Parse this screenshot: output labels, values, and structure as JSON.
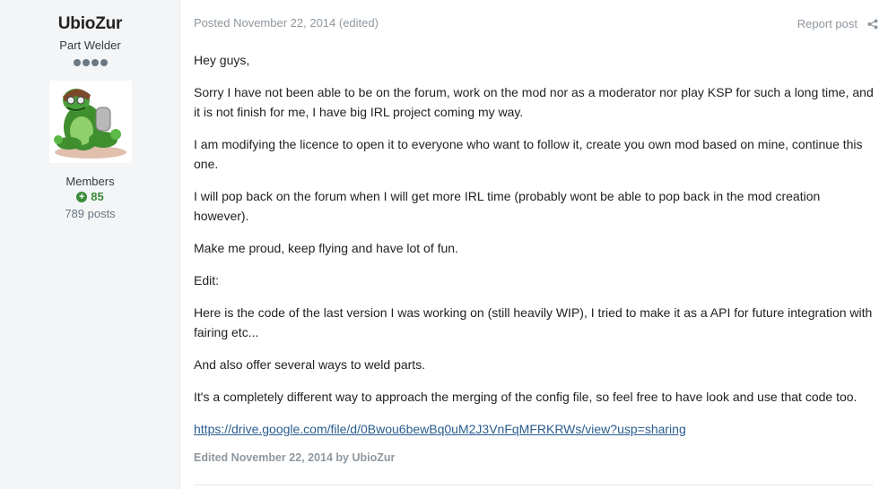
{
  "author": {
    "name": "UbioZur",
    "rank": "Part Welder",
    "pips": 4,
    "group": "Members",
    "reputation": "85",
    "posts": "789 posts"
  },
  "post": {
    "meta": "Posted November 22, 2014 (edited)",
    "report_label": "Report post",
    "paragraphs": [
      "Hey guys,",
      "Sorry I have not been able to be on the forum, work on the mod nor as a moderator nor play KSP for such a long time, and it is not finish for me, I have big IRL project coming my way.",
      "I am modifying the licence to open it to everyone who want to follow it, create you own mod based on mine, continue this one.",
      "I will pop back on the forum when I will get more IRL time (probably wont be able to pop back in the mod creation however).",
      "Make me proud, keep flying and have lot of fun.",
      "Edit:",
      "Here is the code of the last version I was working on (still heavily WIP), I tried to make it as a API for future integration with fairing etc...",
      "And also offer several ways to weld parts.",
      "It's a completely different way to approach the merging of the config file, so feel free to have look and use that code too."
    ],
    "link": "https://drive.google.com/file/d/0Bwou6bewBq0uM2J3VnFqMFRKRWs/view?usp=sharing",
    "edited": "Edited November 22, 2014 by UbioZur"
  },
  "colors": {
    "sidebar_bg": "#f3f5f7",
    "reputation_green": "#3a8b3a",
    "link_blue": "#2a5d8f",
    "muted_gray": "#8e979f"
  },
  "icons": [
    "plus-circle-icon",
    "share-icon"
  ]
}
